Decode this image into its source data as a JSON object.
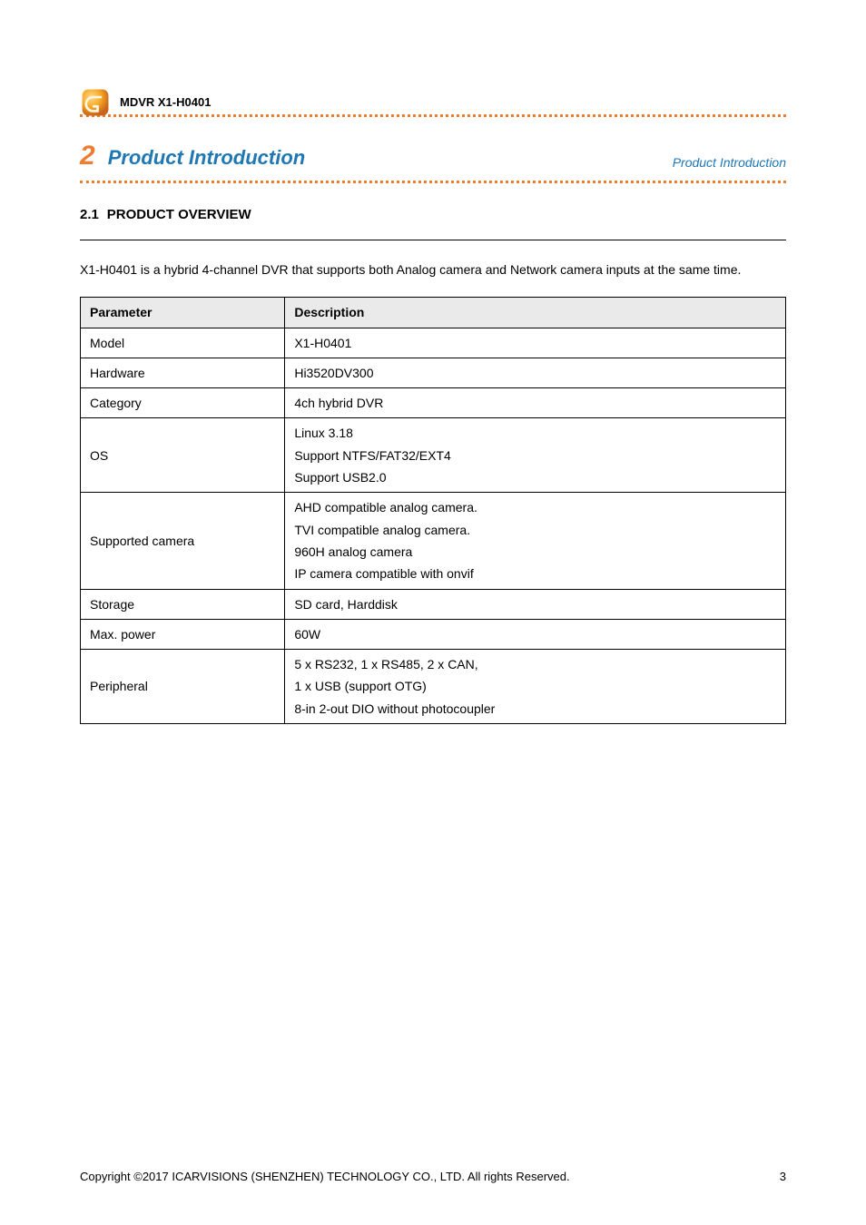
{
  "header": {
    "product_title": "MDVR  X1-H0401"
  },
  "section": {
    "number": "2",
    "heading": "Product Introduction",
    "caption": "Product Introduction"
  },
  "chapter": {
    "number": "2.1",
    "title": "PRODUCT OVERVIEW"
  },
  "intro": "X1-H0401 is a hybrid 4-channel DVR that supports both Analog camera and Network camera inputs at the same time.",
  "table": {
    "headers": {
      "param": "Parameter",
      "desc": "Description"
    },
    "rows": [
      {
        "param": "Model",
        "desc": "X1-H0401"
      },
      {
        "param": "Hardware",
        "desc": "Hi3520DV300"
      },
      {
        "param": "Category",
        "desc": "4ch hybrid DVR"
      },
      {
        "param": "OS",
        "desc": [
          "Linux 3.18",
          "Support NTFS/FAT32/EXT4",
          "Support USB2.0"
        ]
      },
      {
        "param": "Supported camera",
        "desc": [
          "AHD compatible analog camera.",
          "TVI compatible analog camera.",
          "960H analog camera",
          "IP camera compatible with onvif"
        ]
      },
      {
        "param": "Storage",
        "desc": "SD card, Harddisk"
      },
      {
        "param": "Max. power",
        "desc": "60W"
      },
      {
        "param": "Peripheral",
        "desc": [
          "5 x RS232, 1 x  RS485,  2 x CAN,",
          "1 x USB (support OTG)",
          "8-in 2-out DIO without photocoupler"
        ]
      }
    ]
  },
  "footer": {
    "copyright": "Copyright ©2017  ICARVISIONS (SHENZHEN) TECHNOLOGY CO., LTD. All rights Reserved.",
    "page": "3"
  }
}
